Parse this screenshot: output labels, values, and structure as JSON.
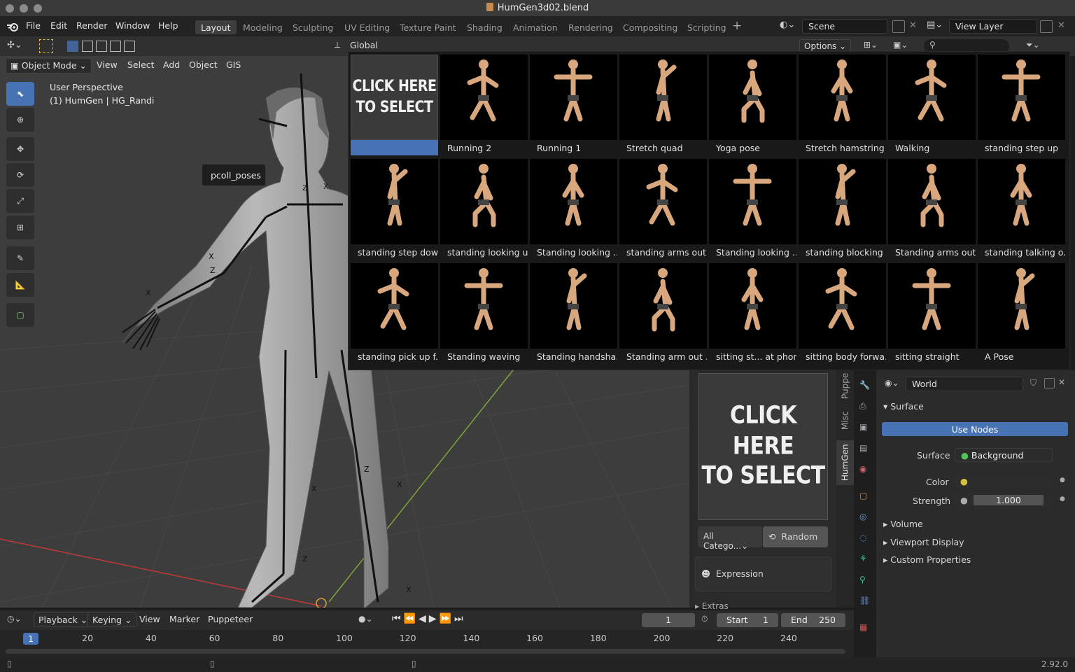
{
  "window": {
    "title": "HumGen3d02.blend"
  },
  "menu": [
    "File",
    "Edit",
    "Render",
    "Window",
    "Help"
  ],
  "workspaces": [
    {
      "label": "Layout",
      "active": true
    },
    {
      "label": "Modeling"
    },
    {
      "label": "Sculpting"
    },
    {
      "label": "UV Editing"
    },
    {
      "label": "Texture Paint"
    },
    {
      "label": "Shading"
    },
    {
      "label": "Animation"
    },
    {
      "label": "Rendering"
    },
    {
      "label": "Compositing"
    },
    {
      "label": "Scripting"
    }
  ],
  "scene": {
    "name": "Scene"
  },
  "view_layer": {
    "name": "View Layer"
  },
  "header2": {
    "orientation": "Global",
    "options": "Options"
  },
  "header3": {
    "mode": "Object Mode",
    "menus": [
      "View",
      "Select",
      "Add",
      "Object",
      "GIS"
    ]
  },
  "viewport": {
    "perspective": "User Perspective",
    "object_info": "(1) HumGen | HG_Randi",
    "tooltip": "pcoll_poses"
  },
  "gallery": {
    "placeholder_line1": "CLICK HERE",
    "placeholder_line2": "TO SELECT",
    "poses": [
      "Running 2",
      "Running 1",
      "Stretch quad",
      "Yoga pose",
      "Stretch hamstring",
      "Walking",
      "standing step up",
      "standing step down",
      "standing looking up",
      "Standing looking ...",
      "standing arms out...",
      "Standing looking ...",
      "standing blocking ...",
      "Standing arms out",
      "standing talking o...",
      "standing pick up f...",
      "Standing waving",
      "Standing handsha...",
      "Standing arm out ...",
      "sitting st... at phone",
      "sitting body forwa...",
      "sitting straight",
      "A Pose"
    ]
  },
  "humgen": {
    "placeholder_line1": "CLICK HERE",
    "placeholder_line2": "TO SELECT",
    "category": "All Catego...",
    "random": "Random",
    "expression": "Expression",
    "extras": "Extras",
    "tabs": [
      "HumGen",
      "Misc",
      "Puppe"
    ]
  },
  "world": {
    "name": "World",
    "surface_header": "Surface",
    "use_nodes": "Use Nodes",
    "surface_label": "Surface",
    "surface_value": "Background",
    "color_label": "Color",
    "strength_label": "Strength",
    "strength_value": "1.000",
    "sections": [
      "Volume",
      "Viewport Display",
      "Custom Properties"
    ]
  },
  "timeline": {
    "menus": [
      "Playback",
      "Keying",
      "View",
      "Marker",
      "Puppeteer"
    ],
    "current_frame": "1",
    "start_label": "Start",
    "start": "1",
    "end_label": "End",
    "end": "250",
    "ticks": [
      "1",
      "20",
      "40",
      "60",
      "80",
      "100",
      "120",
      "140",
      "160",
      "180",
      "200",
      "220",
      "240"
    ]
  },
  "status": {
    "version": "2.92.0"
  },
  "colors": {
    "accent": "#4772b3",
    "x_axis": "#c13a3a",
    "y_axis": "#7fa33a"
  }
}
